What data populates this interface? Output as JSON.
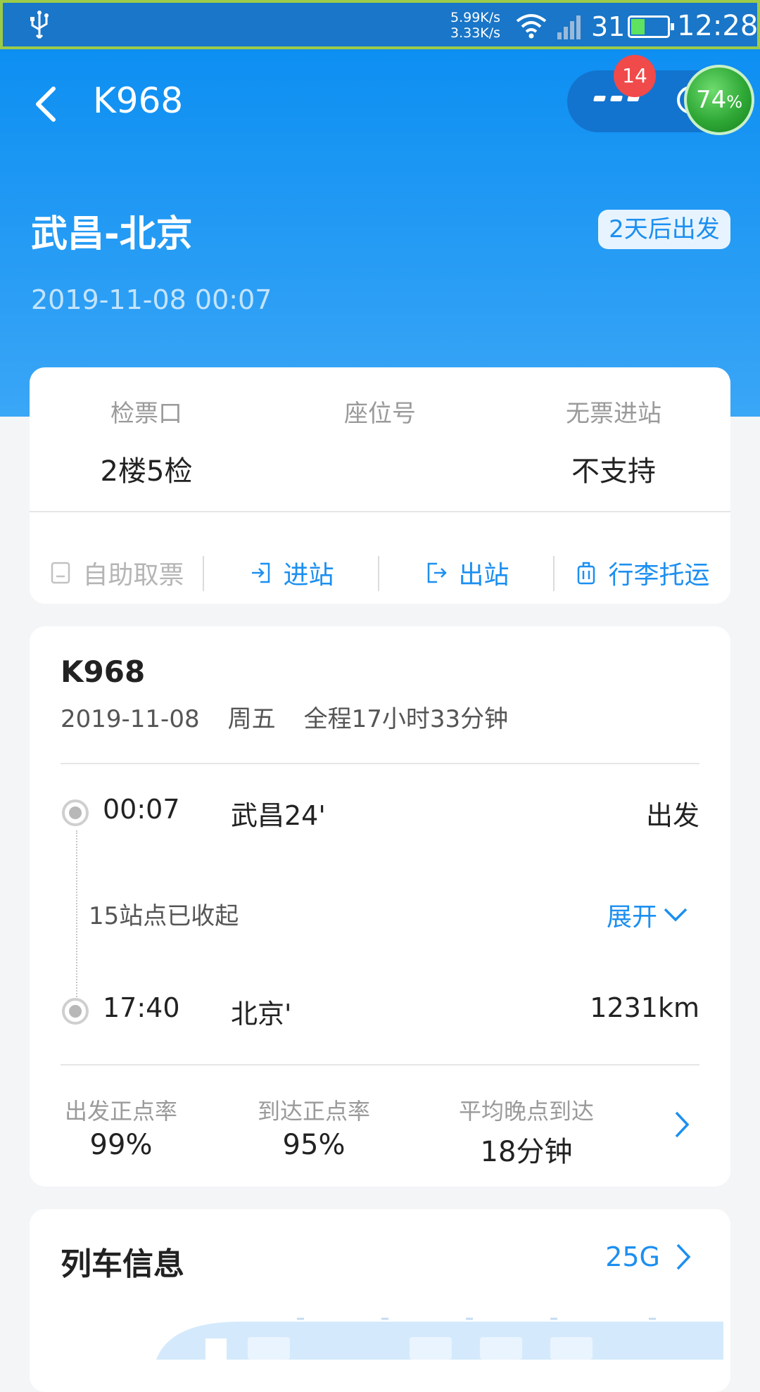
{
  "status_bar": {
    "speed_down": "5.99K/s",
    "speed_up": "3.33K/s",
    "signal_number": "31",
    "battery_level": 0.35,
    "time": "12:28"
  },
  "nav": {
    "title": "K968",
    "badge_count": "14",
    "progress_label": "74",
    "progress_unit": "%"
  },
  "route": {
    "title": "武昌-北京",
    "depart_badge": "2天后出发",
    "datetime": "2019-11-08 00:07"
  },
  "ticket_info": {
    "gate_label": "检票口",
    "gate_value": "2楼5检",
    "seat_label": "座位号",
    "seat_value": "",
    "noticket_label": "无票进站",
    "noticket_value": "不支持"
  },
  "actions": {
    "self_pickup": "自助取票",
    "enter": "进站",
    "exit": "出站",
    "baggage": "行李托运"
  },
  "train": {
    "number": "K968",
    "date": "2019-11-08",
    "weekday": "周五",
    "duration": "全程17小时33分钟",
    "depart_time": "00:07",
    "depart_station": "武昌24'",
    "depart_label": "出发",
    "collapsed": "15站点已收起",
    "expand": "展开",
    "arrive_time": "17:40",
    "arrive_station": "北京'",
    "distance": "1231km"
  },
  "stats": {
    "depart_rate_label": "出发正点率",
    "depart_rate": "99%",
    "arrive_rate_label": "到达正点率",
    "arrive_rate": "95%",
    "avg_delay_label": "平均晚点到达",
    "avg_delay": "18分钟"
  },
  "train_info": {
    "title": "列车信息",
    "carriage_type": "25G"
  },
  "colors": {
    "primary": "#1c8ff0",
    "header_top": "#0d8ff2",
    "status_bar": "#1976c8",
    "badge": "#f04a4a",
    "progress_green": "#2fa836"
  }
}
